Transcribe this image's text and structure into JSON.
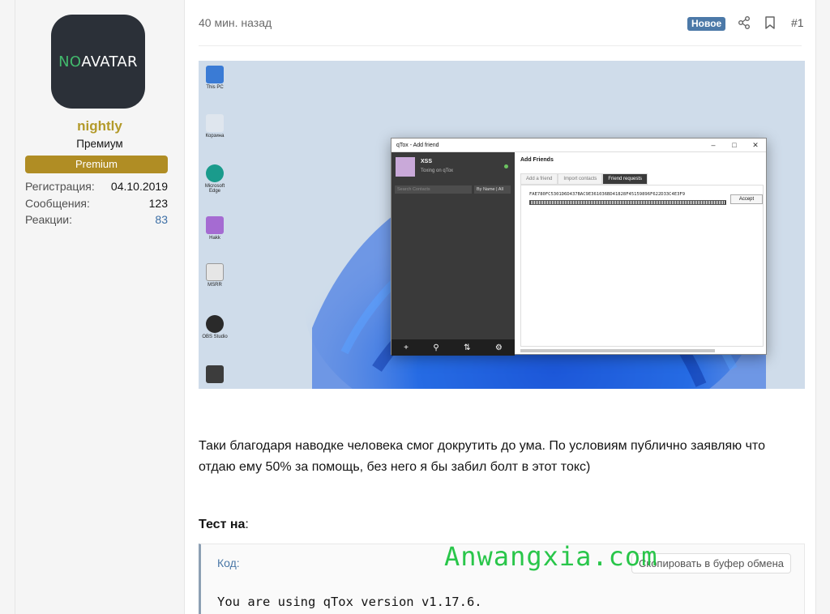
{
  "user": {
    "avatar_no": "NO",
    "avatar_av": "AVATAR",
    "name": "nightly",
    "title": "Премиум",
    "badge": "Premium",
    "stats": [
      {
        "label": "Регистрация:",
        "value": "04.10.2019"
      },
      {
        "label": "Сообщения:",
        "value": "123"
      },
      {
        "label": "Реакции:",
        "value": "83"
      }
    ]
  },
  "post": {
    "time": "40 мин. назад",
    "new_badge": "Новое",
    "number": "#1",
    "share_icon": "share-icon",
    "bookmark_icon": "bookmark-icon",
    "body": "Таки благодаря наводке человека смог докрутить до ума. По условиям публично заявляю что отдаю ему 50% за помощь, без него я бы забил болт в этот токс)",
    "test_heading": "Тест на",
    "test_colon": ":",
    "code": {
      "label": "Код:",
      "copy": "Скопировать в буфер обмена",
      "line": "You are using qTox version v1.17.6."
    }
  },
  "screenshot": {
    "desktop_icons": [
      {
        "label": "This PC",
        "color": "#3a7bd5"
      },
      {
        "label": "Корзина",
        "color": "#dfe6ee"
      },
      {
        "label": "Microsoft Edge",
        "color": "#1a9b8c"
      },
      {
        "label": "Hakk",
        "color": "#a56bd2"
      },
      {
        "label": "MSRR",
        "color": "#e6e6e6"
      },
      {
        "label": "OBS Studio",
        "color": "#2a2a2a"
      },
      {
        "label": "",
        "color": "#3c3c3c"
      }
    ],
    "window_title": "qTox - Add friend",
    "contact_name": "XSS",
    "contact_status": "Toxing on qTox",
    "search_placeholder": "Search Contacts",
    "sort": "By Name | All",
    "add_friends": "Add Friends",
    "tabs": [
      "Add a friend",
      "Import contacts",
      "Friend requests"
    ],
    "friend_id": "FAE780FC5301D6D437BAC9E361036BD41828F45159896F622D33C4E3F9",
    "accept": "Accept"
  },
  "watermark": "Anwangxia.com"
}
